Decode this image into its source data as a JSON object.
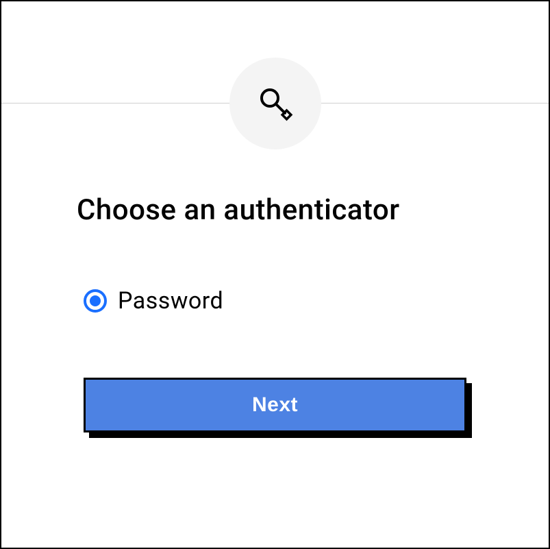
{
  "title": "Choose an authenticator",
  "options": [
    {
      "label": "Password",
      "selected": true
    }
  ],
  "nextButton": {
    "label": "Next"
  },
  "icon": "key-icon",
  "colors": {
    "accent": "#1a6fff",
    "button": "#4d82e3"
  }
}
